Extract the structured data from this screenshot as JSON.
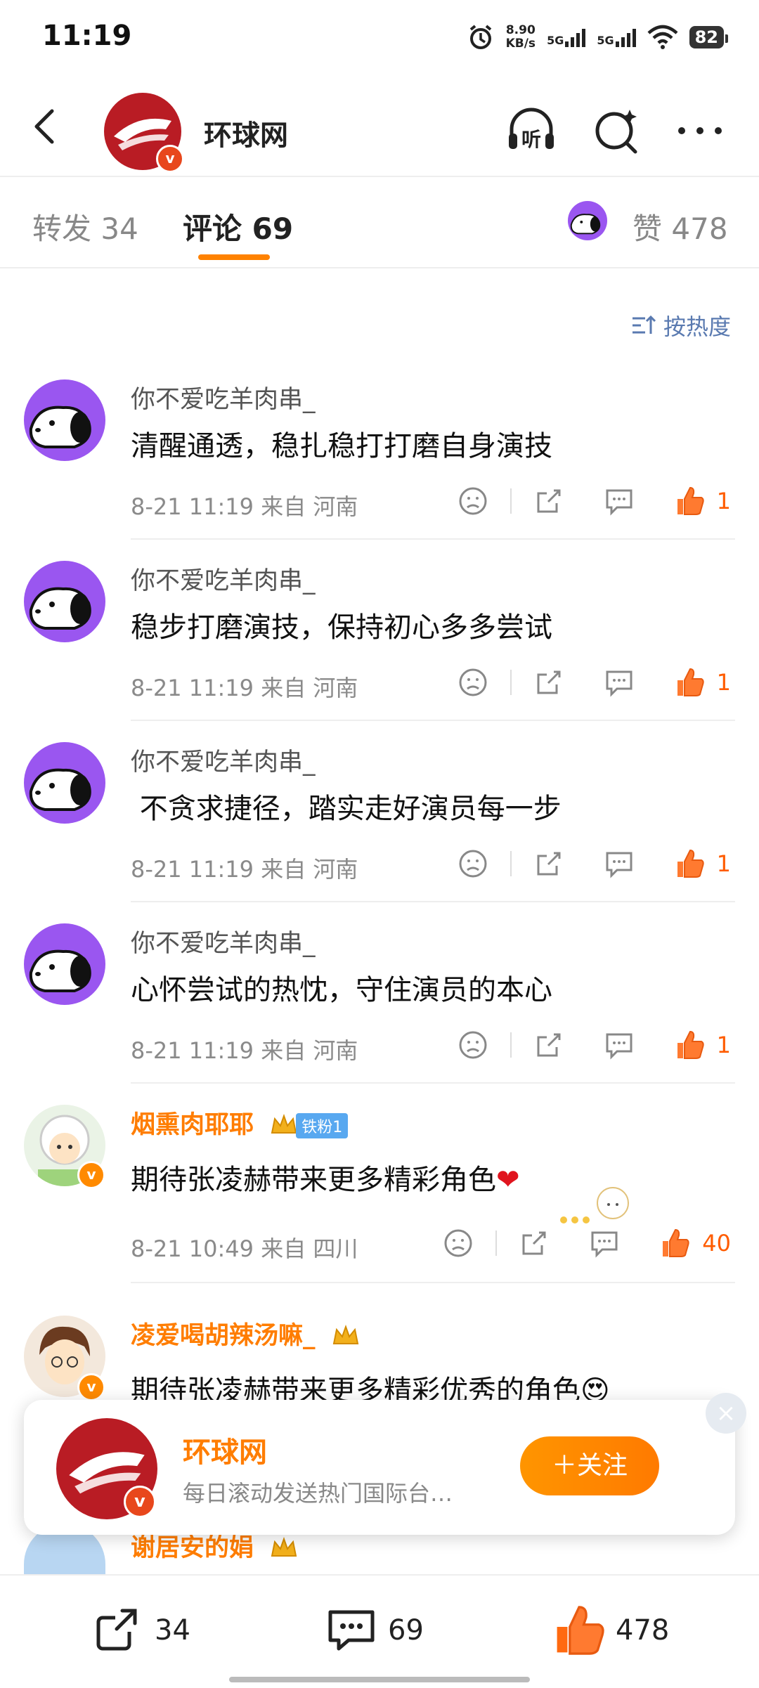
{
  "status_bar": {
    "time": "11:19",
    "net_speed_value": "8.90",
    "net_speed_unit": "KB/s",
    "sim1": "5G",
    "sim2": "5G",
    "battery": "82"
  },
  "header": {
    "channel_name": "环球网",
    "listen_label": "听"
  },
  "tabs": {
    "repost_label": "转发",
    "repost_count": "34",
    "comment_label": "评论",
    "comment_count": "69",
    "like_label": "赞",
    "like_count": "478"
  },
  "sort_label": "按热度",
  "comments": [
    {
      "user": "你不爱吃羊肉串_",
      "text": "清醒通透，稳扎稳打打磨自身演技",
      "time": "8-21 11:19",
      "from_label": "来自",
      "location": "河南",
      "likes": "1"
    },
    {
      "user": "你不爱吃羊肉串_",
      "text": "稳步打磨演技，保持初心多多尝试",
      "time": "8-21 11:19",
      "from_label": "来自",
      "location": "河南",
      "likes": "1"
    },
    {
      "user": "你不爱吃羊肉串_",
      "text": " 不贪求捷径，踏实走好演员每一步",
      "time": "8-21 11:19",
      "from_label": "来自",
      "location": "河南",
      "likes": "1"
    },
    {
      "user": "你不爱吃羊肉串_",
      "text": "心怀尝试的热忱，守住演员的本心",
      "time": "8-21 11:19",
      "from_label": "来自",
      "location": "河南",
      "likes": "1"
    },
    {
      "user": "烟熏肉耶耶",
      "fan_badge": "铁粉1",
      "text": "期待张凌赫带来更多精彩角色",
      "emoji": "❤",
      "time": "8-21 10:49",
      "from_label": "来自",
      "location": "四川",
      "likes": "40"
    },
    {
      "user": "凌爱喝胡辣汤嘛_",
      "text": "期待张凌赫带来更多精彩优秀的角色",
      "emoji": "😍"
    },
    {
      "user": "谢居安的娟"
    }
  ],
  "follow_card": {
    "name": "环球网",
    "description": "每日滚动发送热门国际台…",
    "follow_button": "＋关注",
    "close": "×"
  },
  "bottom_bar": {
    "repost_count": "34",
    "comment_count": "69",
    "like_count": "478"
  },
  "colors": {
    "accent_orange": "#ff8200",
    "like_orange": "#ff5c00",
    "brand_red": "#b91c24",
    "avatar_purple": "#9a56f0",
    "sort_blue": "#5a7ab0"
  }
}
